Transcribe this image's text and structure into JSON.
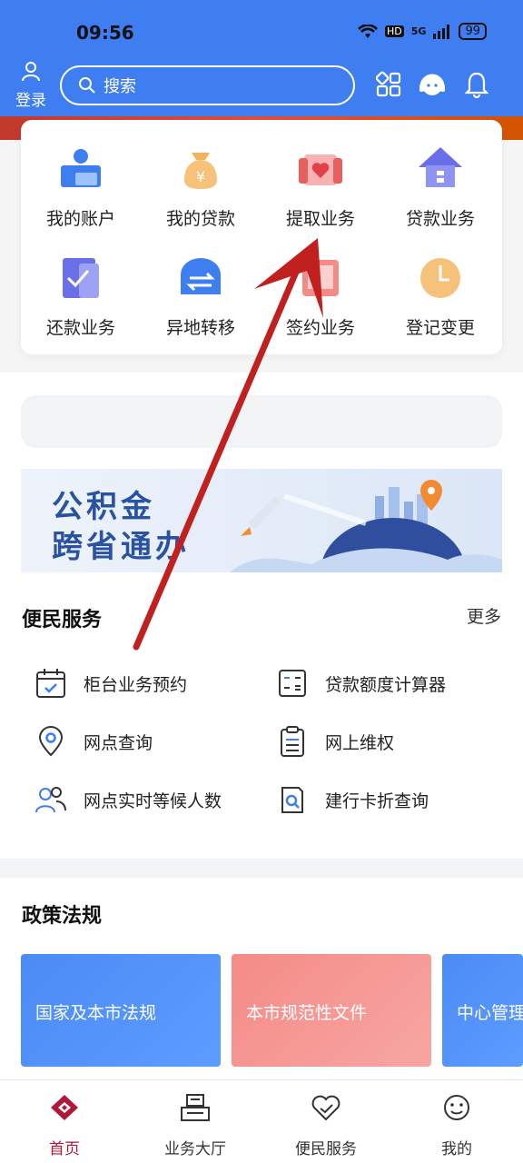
{
  "status_bar": {
    "time": "09:56",
    "network": "5G",
    "hd": "HD",
    "battery": "99"
  },
  "header": {
    "login_label": "登录",
    "search_placeholder": "搜索",
    "icons": [
      "grid-icon",
      "customer-service-icon",
      "bell-icon"
    ]
  },
  "quick_grid": [
    {
      "label": "我的账户",
      "icon": "account-icon"
    },
    {
      "label": "我的贷款",
      "icon": "money-bag-icon"
    },
    {
      "label": "提取业务",
      "icon": "heart-gift-icon"
    },
    {
      "label": "贷款业务",
      "icon": "house-icon"
    },
    {
      "label": "还款业务",
      "icon": "checked-doc-icon"
    },
    {
      "label": "异地转移",
      "icon": "transfer-icon"
    },
    {
      "label": "签约业务",
      "icon": "contract-icon"
    },
    {
      "label": "登记变更",
      "icon": "clock-icon"
    }
  ],
  "banner": {
    "line1": "公积金",
    "line2": "跨省通办"
  },
  "convenience": {
    "title": "便民服务",
    "more": "更多",
    "items": [
      {
        "label": "柜台业务预约",
        "icon": "calendar-icon"
      },
      {
        "label": "贷款额度计算器",
        "icon": "calculator-icon"
      },
      {
        "label": "网点查询",
        "icon": "location-icon"
      },
      {
        "label": "网上维权",
        "icon": "clipboard-icon"
      },
      {
        "label": "网点实时等候人数",
        "icon": "people-icon"
      },
      {
        "label": "建行卡折查询",
        "icon": "search-doc-icon"
      }
    ]
  },
  "policy": {
    "title": "政策法规",
    "cards": [
      {
        "label": "国家及本市法规",
        "color": "#4a8bf5"
      },
      {
        "label": "本市规范性文件",
        "color": "#f48b87"
      },
      {
        "label": "中心管理",
        "color": "#4a8bf5"
      }
    ]
  },
  "tabbar": [
    {
      "label": "首页",
      "icon": "home-logo-icon",
      "active": true
    },
    {
      "label": "业务大厅",
      "icon": "hall-icon",
      "active": false
    },
    {
      "label": "便民服务",
      "icon": "heart-hand-icon",
      "active": false
    },
    {
      "label": "我的",
      "icon": "smile-icon",
      "active": false
    }
  ],
  "colors": {
    "primary": "#3f7ef0",
    "accent_red": "#b0183a",
    "arrow": "#c0201e"
  }
}
